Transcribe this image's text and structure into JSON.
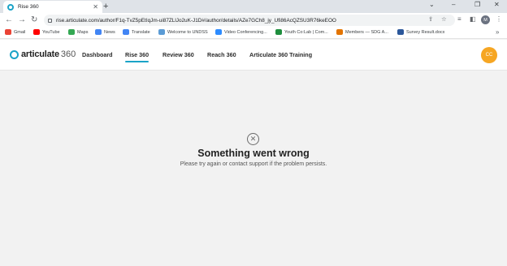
{
  "browser": {
    "tab_title": "Rise 360",
    "tab_close": "✕",
    "new_tab": "+",
    "url": "rise.articulate.com/author/F1q-TvZ5pEtIqJm-ui87ZLlJo2uK-J1D#/author/details/AZe7GCh8_jy_Ufi86AcQZSU3R76keEOO",
    "window_controls": {
      "collapse": "⌄",
      "minimize": "–",
      "maximize": "❐",
      "close": "✕"
    },
    "nav": {
      "back": "←",
      "forward": "→",
      "reload": "↻"
    },
    "profile_initial": "M",
    "bookmarks": [
      {
        "label": "Gmail",
        "color": "#ea4335"
      },
      {
        "label": "YouTube",
        "color": "#ff0000"
      },
      {
        "label": "Maps",
        "color": "#34a853"
      },
      {
        "label": "News",
        "color": "#4285f4"
      },
      {
        "label": "Translate",
        "color": "#4285f4"
      },
      {
        "label": "Welcome to UNDSS",
        "color": "#5b9bd5"
      },
      {
        "label": "Video Conferencing...",
        "color": "#2d8cff"
      },
      {
        "label": "Youth Co:Lab | Com...",
        "color": "#1e8e3e"
      },
      {
        "label": "Members — SDG A...",
        "color": "#e37400"
      },
      {
        "label": "Survey Result.docx",
        "color": "#2b579a"
      }
    ],
    "more": "»"
  },
  "app": {
    "logo_word": "articulate",
    "logo_num": "360",
    "nav": [
      "Dashboard",
      "Rise 360",
      "Review 360",
      "Reach 360",
      "Articulate 360 Training"
    ],
    "active_index": 1,
    "avatar_initials": "CC",
    "accent": "#1aa3c7",
    "avatar_color": "#f6a623"
  },
  "error": {
    "icon": "✕",
    "title": "Something went wrong",
    "message": "Please try again or contact support if the problem persists."
  }
}
